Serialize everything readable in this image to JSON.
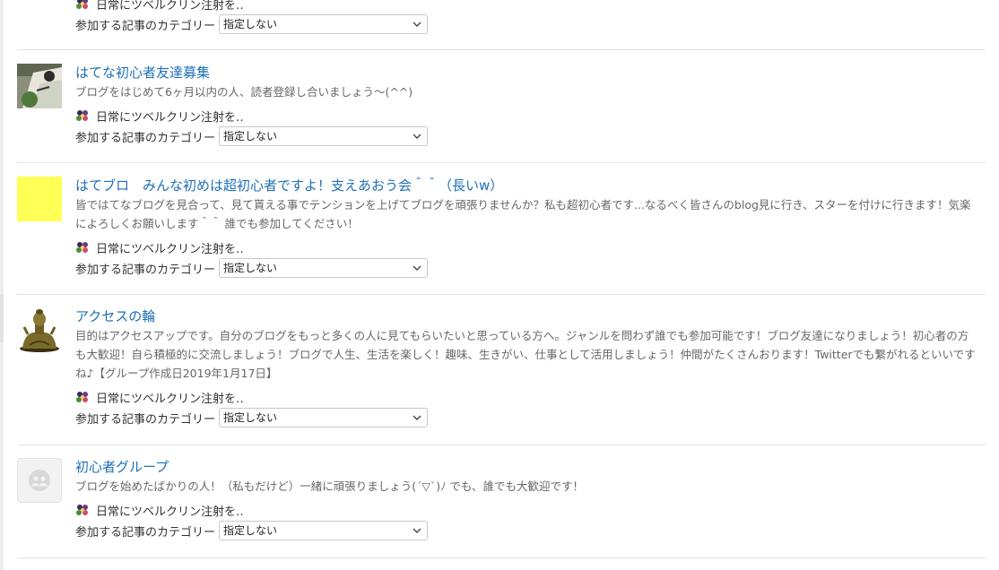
{
  "items": [
    {
      "title": "",
      "description": "",
      "blog_name": "日常にツベルクリン注射を‥",
      "category_label": "参加する記事のカテゴリー",
      "category_value": "指定しない",
      "thumb": "photo-card"
    },
    {
      "title": "はてな初心者友達募集",
      "description": "ブログをはじめて6ヶ月以内の人、読者登録し合いましょう〜(^^)",
      "blog_name": "日常にツベルクリン注射を‥",
      "category_label": "参加する記事のカテゴリー",
      "category_value": "指定しない",
      "thumb": "photo-card"
    },
    {
      "title": "はてブロ　みんな初めは超初心者ですよ！支えあおう会＾＾（長いw）",
      "description": "皆ではてなブログを見合って、見て貰える事でテンションを上げてブログを頑張りませんか？私も超初心者です...なるべく皆さんのblog見に行き、スターを付けに行きます！気楽によろしくお願いします＾＾ 誰でも参加してください！",
      "blog_name": "日常にツベルクリン注射を‥",
      "category_label": "参加する記事のカテゴリー",
      "category_value": "指定しない",
      "thumb": "yellow-square"
    },
    {
      "title": "アクセスの輪",
      "description": "目的はアクセスアップです。自分のブログをもっと多くの人に見てもらいたいと思っている方へ。ジャンルを問わず誰でも参加可能です！ブログ友達になりましょう！初心者の方も大歓迎！自ら積極的に交流しましょう！ブログで人生、生活を楽しく！趣味、生きがい、仕事として活用しましょう！仲間がたくさんおります！Twitterでも繋がれるといいですね♪【グループ作成日2019年1月17日】",
      "blog_name": "日常にツベルクリン注射を‥",
      "category_label": "参加する記事のカテゴリー",
      "category_value": "指定しない",
      "thumb": "buddha-statue"
    },
    {
      "title": "初心者グループ",
      "description": "ブログを始めたばかりの人！（私もだけど）一緒に頑張りましょう(´▽`)ﾉ でも、誰でも大歓迎です！",
      "blog_name": "日常にツベルクリン注射を‥",
      "category_label": "参加する記事のカテゴリー",
      "category_value": "指定しない",
      "thumb": "default-group-avatar"
    }
  ],
  "colors": {
    "title": "#1f6fb5",
    "description": "#666666",
    "divider": "#e2e2e2",
    "yellow_thumb": "#ffff55"
  },
  "icons": {
    "blog": "blog-avatar-icon",
    "dropdown": "chevron-down-icon"
  }
}
